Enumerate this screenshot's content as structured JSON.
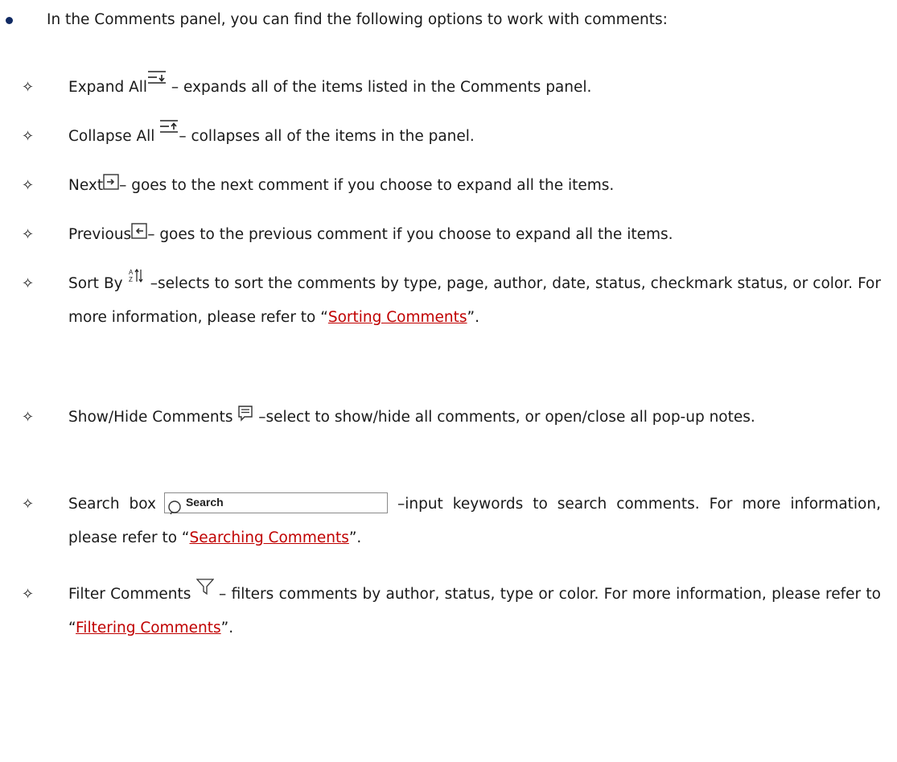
{
  "intro": "In the Comments panel, you can find the following options to work with comments:",
  "colors": {
    "link": "#c00000",
    "bullet": "#102a63"
  },
  "items": [
    {
      "name": "Expand All",
      "icon": "expand-all-icon",
      "desc": " – expands all of the items listed in the Comments panel."
    },
    {
      "name": "Collapse All ",
      "icon": "collapse-all-icon",
      "desc": "– collapses all of the items in the panel."
    },
    {
      "name": "Next",
      "icon": "next-comment-icon",
      "desc": "– goes to the next comment if you choose to expand all the items."
    },
    {
      "name": "Previous",
      "icon": "previous-comment-icon",
      "desc": "– goes to the previous comment if you choose to expand all the items."
    },
    {
      "name": "Sort By ",
      "icon": "sort-by-icon",
      "desc": "–selects to sort the comments by type, page, author, date, status, checkmark status, or color. For more information, please refer to “",
      "link": "Sorting Comments",
      "after": "”."
    },
    {
      "name": "Show/Hide Comments ",
      "icon": "comment-icon",
      "desc": "–select to show/hide all comments, or open/close all pop-up notes."
    },
    {
      "name": "Search box",
      "icon": "search-icon",
      "search_placeholder": "Search",
      "desc": "–input keywords to search comments. For more information, please refer to “",
      "link": "Searching Comments",
      "after": "”."
    },
    {
      "name": "Filter Comments ",
      "icon": "filter-icon",
      "desc": " – filters comments by author, status, type or color. For more information, please refer to “",
      "link": "Filtering Comments",
      "after": "”."
    }
  ]
}
